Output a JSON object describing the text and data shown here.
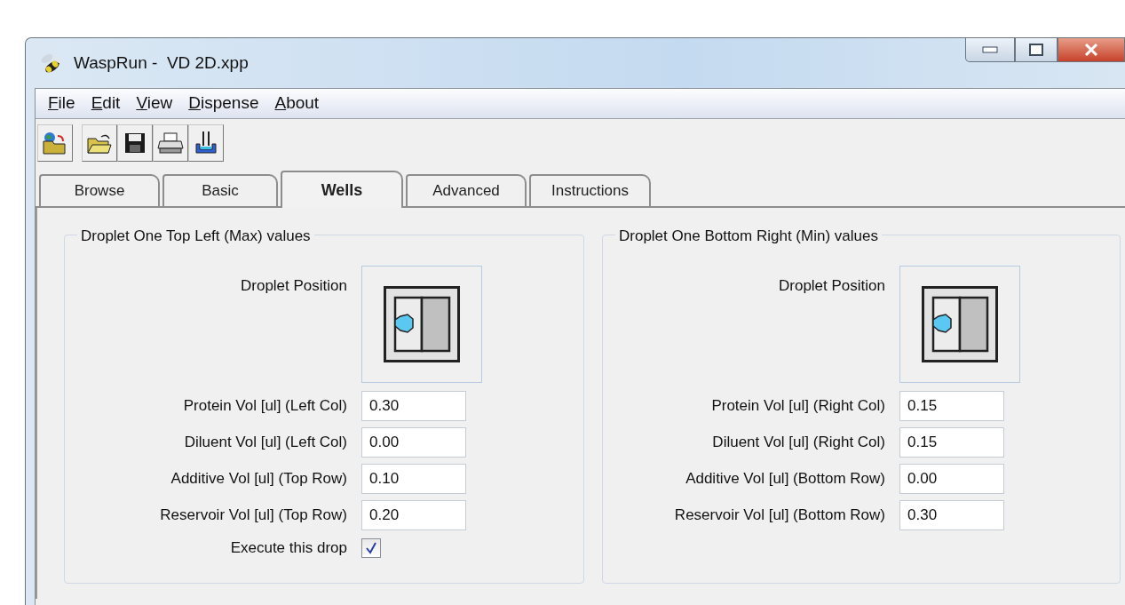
{
  "window": {
    "title": "WaspRun -  VD 2D.xpp"
  },
  "menu": [
    "File",
    "Edit",
    "View",
    "Dispense",
    "About"
  ],
  "tabs": [
    {
      "label": "Browse",
      "selected": false
    },
    {
      "label": "Basic",
      "selected": false
    },
    {
      "label": "Wells",
      "selected": true
    },
    {
      "label": "Advanced",
      "selected": false
    },
    {
      "label": "Instructions",
      "selected": false
    }
  ],
  "panels": [
    {
      "title": "Droplet One Top Left (Max) values",
      "droplet_label": "Droplet Position",
      "fields": [
        {
          "label": "Protein Vol [ul] (Left Col)",
          "value": "0.30"
        },
        {
          "label": "Diluent Vol [ul] (Left Col)",
          "value": "0.00"
        },
        {
          "label": "Additive Vol [ul] (Top Row)",
          "value": "0.10"
        },
        {
          "label": "Reservoir Vol [ul] (Top Row)",
          "value": "0.20"
        }
      ],
      "execute": {
        "label": "Execute this drop",
        "checked": true
      }
    },
    {
      "title": "Droplet One Bottom Right (Min) values",
      "droplet_label": "Droplet Position",
      "fields": [
        {
          "label": "Protein Vol [ul] (Right Col)",
          "value": "0.15"
        },
        {
          "label": "Diluent Vol [ul] (Right Col)",
          "value": "0.15"
        },
        {
          "label": "Additive Vol [ul] (Bottom Row)",
          "value": "0.00"
        },
        {
          "label": "Reservoir Vol [ul] (Bottom Row)",
          "value": "0.30"
        }
      ]
    }
  ]
}
